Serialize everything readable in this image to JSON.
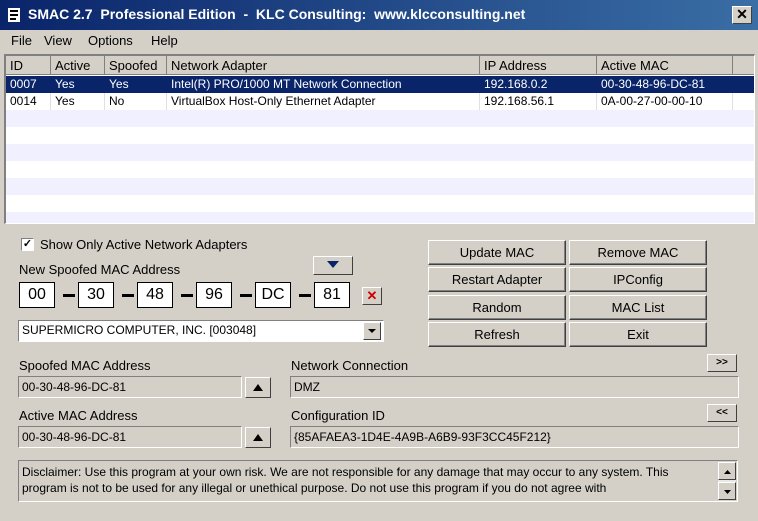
{
  "window": {
    "title": "SMAC 2.7  Professional Edition  -  KLC Consulting:  www.klcconsulting.net",
    "close_label": "✕"
  },
  "menu": [
    "File",
    "View",
    "Options",
    "Help"
  ],
  "table": {
    "columns": [
      "ID",
      "Active",
      "Spoofed",
      "Network Adapter",
      "IP Address",
      "Active MAC"
    ],
    "rows": [
      [
        "0007",
        "Yes",
        "Yes",
        "Intel(R) PRO/1000 MT Network Connection",
        "192.168.0.2",
        "00-30-48-96-DC-81"
      ],
      [
        "0014",
        "Yes",
        "No",
        "VirtualBox Host-Only Ethernet Adapter",
        "192.168.56.1",
        "0A-00-27-00-00-10"
      ]
    ],
    "selected_row": 0
  },
  "filter": {
    "show_active_label": "Show Only Active Network Adapters",
    "checked": true
  },
  "new_mac": {
    "label": "New Spoofed MAC Address",
    "octets": [
      "00",
      "30",
      "48",
      "96",
      "DC",
      "81"
    ]
  },
  "vendor_select": "SUPERMICRO COMPUTER, INC. [003048]",
  "buttons": {
    "update_mac": "Update MAC",
    "remove_mac": "Remove MAC",
    "restart_adapter": "Restart Adapter",
    "ipconfig": "IPConfig",
    "random": "Random",
    "mac_list": "MAC List",
    "refresh": "Refresh",
    "exit": "Exit",
    "forward": ">>",
    "back": "<<"
  },
  "spoofed_mac": {
    "label": "Spoofed MAC Address",
    "value": "00-30-48-96-DC-81"
  },
  "active_mac": {
    "label": "Active MAC Address",
    "value": "00-30-48-96-DC-81"
  },
  "network_connection": {
    "label": "Network Connection",
    "value": "DMZ"
  },
  "configuration_id": {
    "label": "Configuration ID",
    "value": "{85AFAEA3-1D4E-4A9B-A6B9-93F3CC45F212}"
  },
  "disclaimer": "Disclaimer: Use this program at your own risk.  We are not responsible for any damage that may occur to any system.  This program is not to be used for any illegal or unethical purpose.  Do not use this program if you do not agree with"
}
